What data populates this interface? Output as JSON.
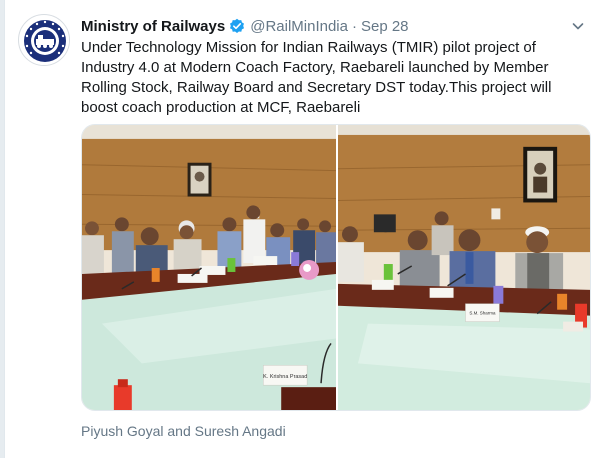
{
  "tweet": {
    "author_name": "Ministry of Railways",
    "handle": "@RailMinIndia",
    "separator": "·",
    "date": "Sep 28",
    "text": "Under Technology Mission for Indian Railways (TMIR) pilot project of Industry 4.0 at Modern Coach Factory, Raebareli  launched by Member Rolling Stock, Railway Board and Secretary DST today.This  project will boost coach production at MCF, Raebareli",
    "media_caption": "Piyush Goyal and Suresh Angadi"
  },
  "photo_labels": {
    "left_nameplate": "K. Krishna Prasad",
    "right_nameplate": "S.M. Sharma"
  },
  "icons": {
    "avatar": "indian-railways-logo",
    "verified": "verified-badge-icon",
    "menu": "chevron-down-icon"
  },
  "colors": {
    "accent": "#1da1f2",
    "text": "#14171a",
    "secondary_text": "#657786",
    "logo_blue": "#1b2f7a"
  }
}
